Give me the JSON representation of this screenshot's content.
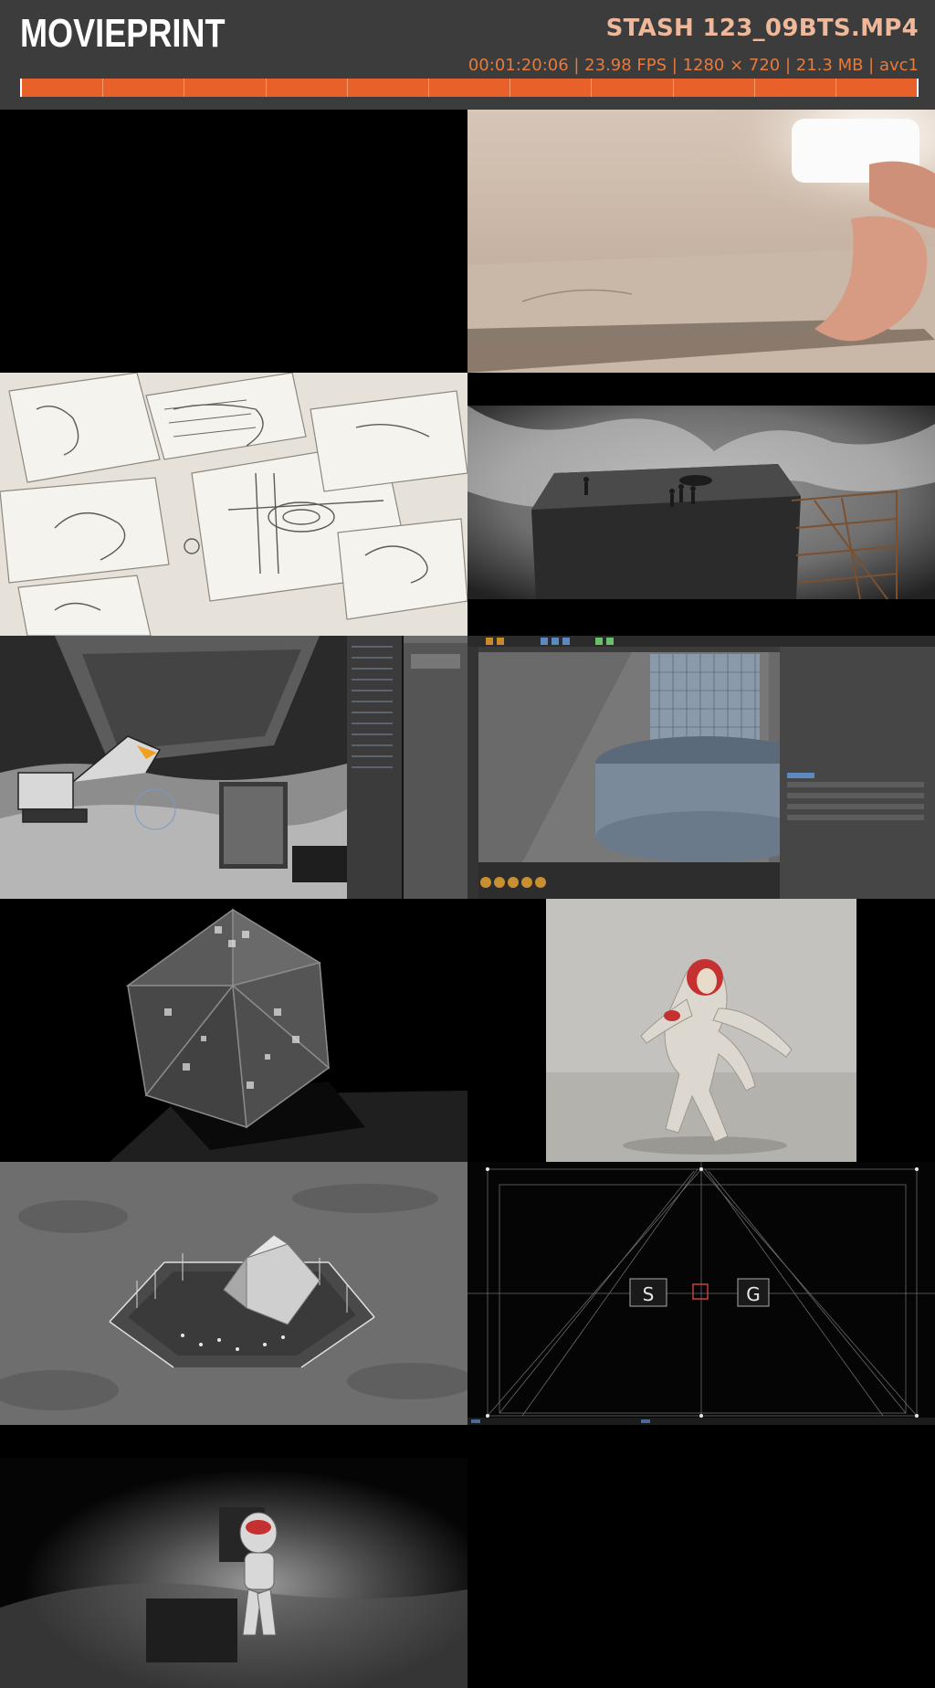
{
  "header": {
    "logo": "MOVIEPRINT",
    "title": "STASH 123_09BTS.MP4",
    "meta": "00:01:20:06 | 23.98 FPS | 1280 × 720 | 21.3 MB | avc1",
    "timeline_segments": 11
  },
  "colors": {
    "header_bg": "#3c3c3c",
    "accent": "#e8602a",
    "title": "#f0b89a",
    "meta": "#e87a3c"
  },
  "thumbnails": [
    {
      "id": 1,
      "subject": "black-frame"
    },
    {
      "id": 2,
      "subject": "hand-flipping-sketchbook"
    },
    {
      "id": 3,
      "subject": "pencil-storyboard-sketches"
    },
    {
      "id": 4,
      "subject": "miniature-tower-with-figures"
    },
    {
      "id": 5,
      "subject": "3d-excavator-mine-scene"
    },
    {
      "id": 6,
      "subject": "3d-software-viewport"
    },
    {
      "id": 7,
      "subject": "icosahedron-render"
    },
    {
      "id": 8,
      "subject": "astronaut-figure"
    },
    {
      "id": 9,
      "subject": "moon-stadium-render"
    },
    {
      "id": 10,
      "subject": "camera-frustum-viewport"
    },
    {
      "id": 11,
      "subject": "seated-astronaut-spotlight"
    },
    {
      "id": 12,
      "subject": "black-frame"
    }
  ]
}
